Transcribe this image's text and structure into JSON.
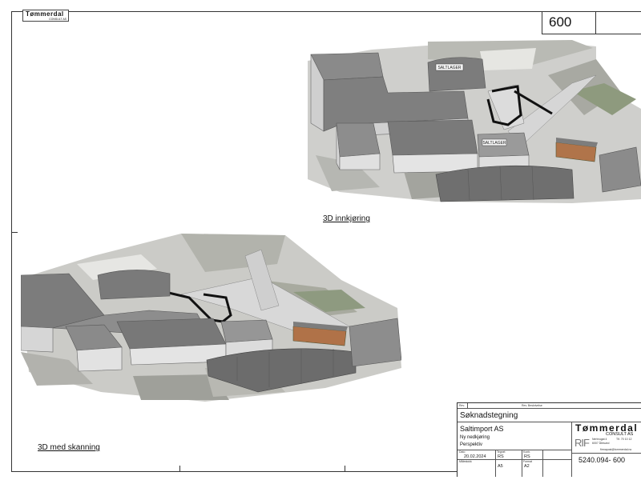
{
  "header": {
    "logo": {
      "name": "Tømmerdal",
      "sub": "CONSULT AS"
    },
    "sheet_number": "600"
  },
  "views": [
    {
      "caption": "3D innkjøring",
      "labels": [
        "SALTLAGER",
        "SALTLAGER"
      ]
    },
    {
      "caption": "3D med skanning"
    }
  ],
  "title_block": {
    "revision_header": [
      "Rev.",
      "Rev. Beskrivelse"
    ],
    "document_title": "Søknadstegning",
    "client": "Saltimport AS",
    "project": "Ny nedkjøring",
    "view_name": "Perspektiv",
    "field_labels": [
      "Dato",
      "Tegnet",
      "Kontr.",
      "Målestokk",
      "Format"
    ],
    "date": "20.02.2024",
    "drawn_by": "RS",
    "checked_by": "RS",
    "scale": "A5",
    "format": "A2",
    "company": {
      "name": "Tømmerdal",
      "consult": "CONSULT AS",
      "rif": "RIF",
      "address": [
        "Nerbrugat 4",
        "6007 Ålesund"
      ],
      "phone": "Tlf. 70 10 12",
      "email": "firmapost@tommerdal.no"
    },
    "drawing_number": "5240.094- 600"
  }
}
